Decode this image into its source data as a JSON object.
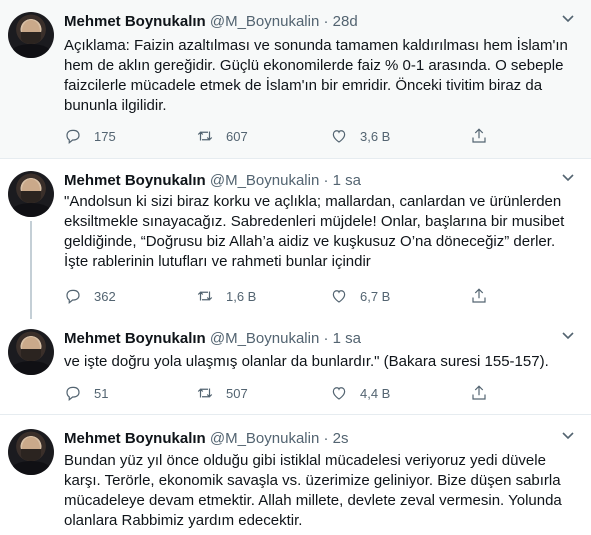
{
  "tweets": [
    {
      "name": "Mehmet Boynukalın",
      "handle": "@M_Boynukalin",
      "dot": "·",
      "time": "28d",
      "text": "Açıklama: Faizin azaltılması ve sonunda tamamen kaldırılması hem İslam'ın\nhem de aklın gereğidir. Güçlü ekonomilerde faiz % 0-1 arasında. O sebeple\nfaizcilerle mücadele etmek de İslam'ın bir emridir. Önceki tivitim biraz da\nbununla ilgilidir.",
      "replies": "175",
      "retweets": "607",
      "likes": "3,6 B"
    },
    {
      "name": "Mehmet Boynukalın",
      "handle": "@M_Boynukalin",
      "dot": "·",
      "time": "1 sa",
      "text": "\"Andolsun ki sizi biraz korku ve açlıkla; mallardan, canlardan ve ürünlerden\neksiltmekle sınayacağız. Sabredenleri müjdele! Onlar, başlarına bir musibet\ngeldiğinde, “Doğrusu biz Allah’a aidiz ve kuşkusuz O’na döneceğiz” derler.\nİşte rablerinin lutufları ve rahmeti bunlar içindir",
      "replies": "362",
      "retweets": "1,6 B",
      "likes": "6,7 B"
    },
    {
      "name": "Mehmet Boynukalın",
      "handle": "@M_Boynukalin",
      "dot": "·",
      "time": "1 sa",
      "text": "ve işte doğru yola ulaşmış olanlar da bunlardır.\" (Bakara suresi 155-157).",
      "replies": "51",
      "retweets": "507",
      "likes": "4,4 B"
    },
    {
      "name": "Mehmet Boynukalın",
      "handle": "@M_Boynukalin",
      "dot": "·",
      "time": "2s",
      "text": "Bundan yüz yıl önce olduğu gibi istiklal mücadelesi veriyoruz yedi düvele\nkarşı. Terörle, ekonomik savaşla vs. üzerimize geliniyor. Bize düşen sabırla\nmücadeleye devam etmektir. Allah millete, devlete zeval vermesin. Yolunda\nolanlara Rabbimiz yardım edecektir."
    }
  ],
  "icons": {
    "reply": "reply-icon",
    "retweet": "retweet-icon",
    "like": "like-icon",
    "share": "share-icon",
    "more": "chevron-down-icon"
  },
  "colors": {
    "highlight_bg": "#f7f9f9",
    "muted": "#536471",
    "thread_line": "#c4cfd6"
  }
}
